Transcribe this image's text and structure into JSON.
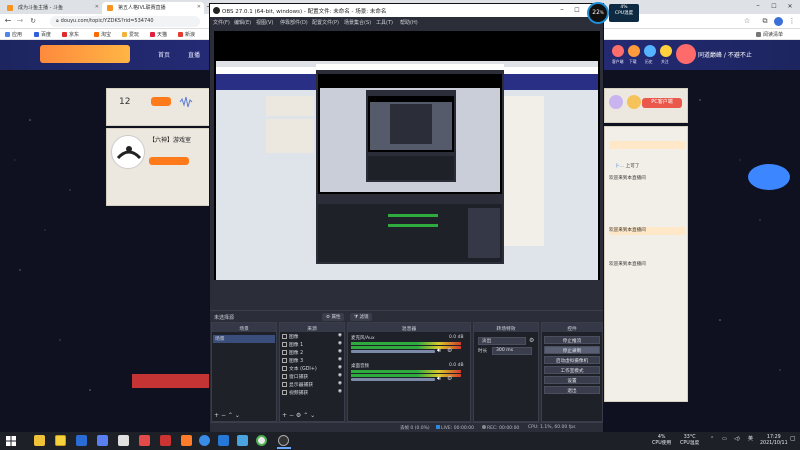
{
  "browser": {
    "tabs": [
      {
        "title": "成为斗鱼主播 - 斗鱼"
      },
      {
        "title": "第五人格IVL联赛直播"
      }
    ],
    "url": "douyu.com/topic/YZDKS?rid=534740",
    "bookmarks": [
      "应用",
      "百度",
      "京东",
      "淘宝",
      "爱玩",
      "天猫",
      "新浪",
      "游戏"
    ],
    "reading_list": "阅读清单"
  },
  "douyu": {
    "nav": [
      "首页",
      "直播"
    ],
    "follow_count": "12",
    "room_title": "【六神】游戏室",
    "pc_client": "PC客户端",
    "banner_slogan": "同道巅峰 / 不避不止",
    "header_icons": [
      "客户端",
      "下载",
      "历史",
      "关注"
    ],
    "chat": [
      {
        "user": "卜…",
        "text": "上可了"
      },
      {
        "user": "",
        "text": "欢迎来到本直播间"
      },
      {
        "user": "",
        "text": "欢迎来到本直播间"
      },
      {
        "user": "",
        "text": "欢迎来到本直播间"
      }
    ]
  },
  "obs": {
    "title": "OBS 27.0.1 (64-bit, windows) - 配置文件: 未命名 - 场景: 未命名",
    "menu": [
      "文件(F)",
      "编辑(E)",
      "视图(V)",
      "停靠部件(D)",
      "配置文件(P)",
      "场景集合(S)",
      "工具(T)",
      "帮助(H)"
    ],
    "current_scene_label": "未选择源",
    "props_button": "属性",
    "filters_button": "滤镜",
    "docks": {
      "scenes": {
        "title": "场景",
        "items": [
          "场景"
        ]
      },
      "sources": {
        "title": "来源",
        "items": [
          "图像",
          "图像 1",
          "图像 2",
          "图像 3",
          "文本 (GDI+)",
          "窗口捕获",
          "显示器捕获",
          "视频捕获"
        ]
      },
      "mixer": {
        "title": "混音器",
        "channels": [
          {
            "name": "麦克风/Aux",
            "db": "0.0 dB"
          },
          {
            "name": "桌面音频",
            "db": "0.0 dB"
          }
        ]
      },
      "transitions": {
        "title": "转场特效",
        "type": "淡出",
        "duration_label": "时长",
        "duration": "300 ms"
      },
      "controls": {
        "title": "控件",
        "buttons": [
          "停止推流",
          "停止录制",
          "启动虚拟摄像机",
          "工作室模式",
          "设置",
          "退出"
        ]
      }
    },
    "status": {
      "live_label": "LIVE:",
      "live_time": "00:00:00",
      "rec_label": "REC:",
      "rec_time": "00:00:00",
      "cpu": "CPU: 1.1%, 60.00 fps",
      "dropped": "丢帧 0 (0.0%)"
    }
  },
  "cpu_widget": {
    "percent": "22",
    "percent_suffix": "%",
    "small_value": "4%",
    "small_label": "CPU温度"
  },
  "taskbar": {
    "tray_cpu": "4%",
    "tray_cpu_label": "CPU使用",
    "tray_temp": "33°C",
    "tray_temp_label": "CPU温度",
    "time": "17:29",
    "date": "2021/10/11",
    "ime": "英"
  }
}
